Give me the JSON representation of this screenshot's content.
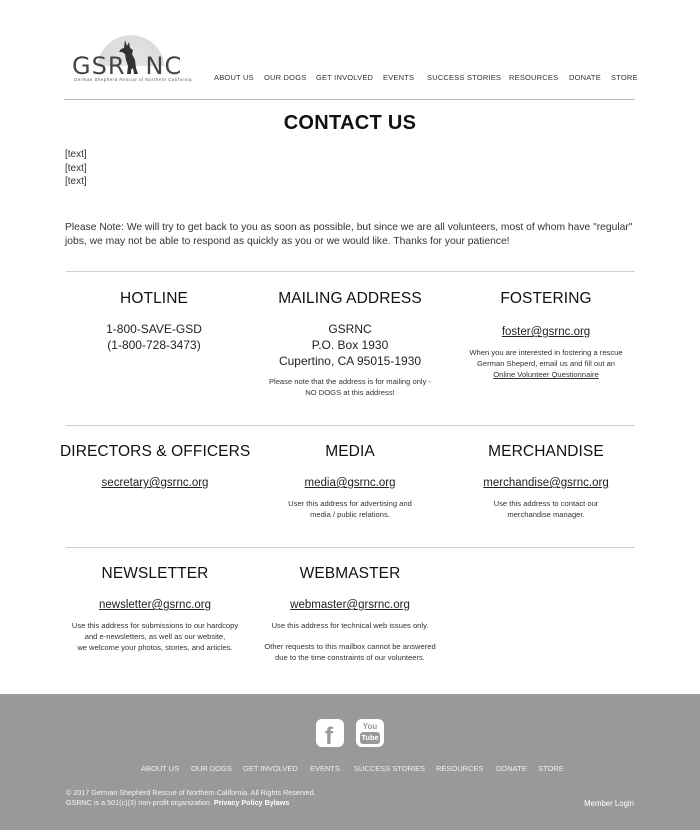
{
  "logo": {
    "text": "GSR",
    "text2": "NC",
    "subtitle": "German Shepherd Rescue of Northern California"
  },
  "nav": [
    {
      "label": "ABOUT US"
    },
    {
      "label": "OUR DOGS"
    },
    {
      "label": "GET INVOLVED"
    },
    {
      "label": "EVENTS"
    },
    {
      "label": "SUCCESS STORIES"
    },
    {
      "label": "RESOURCES"
    },
    {
      "label": "DONATE"
    },
    {
      "label": "STORE"
    }
  ],
  "main": {
    "title": "CONTACT US",
    "placeholders": [
      "[text]",
      "[text]",
      "[text]"
    ],
    "note": "Please Note: We will try to get back to you as soon as possible, but since we are all volunteers, most of whom have \"regular\" jobs, we may not be able to respond as quickly as you or we would like. Thanks for your patience!"
  },
  "contacts": {
    "hotline": {
      "title": "HOTLINE",
      "line1": "1-800-SAVE-GSD",
      "line2": "(1-800-728-3473)"
    },
    "mailing": {
      "title": "MAILING ADDRESS",
      "line1": "GSRNC",
      "line2": "P.O. Box 1930",
      "line3": "Cupertino, CA 95015-1930",
      "note1": "Please note that the address is for mailing only -",
      "note2": "NO DOGS at this address!"
    },
    "fostering": {
      "title": "FOSTERING",
      "email": "foster@gsrnc.org",
      "desc1": "When you are interested in fostering a rescue",
      "desc2": "German Sheperd, email us and fill out an",
      "link": "Online Volunteer Questionnaire"
    },
    "directors": {
      "title": "DIRECTORS & OFFICERS",
      "email": "secretary@gsrnc.org"
    },
    "media": {
      "title": "MEDIA",
      "email": "media@gsrnc.org",
      "desc1": "User this address for advertising and",
      "desc2": "media / public relations."
    },
    "merchandise": {
      "title": "MERCHANDISE",
      "email": "merchandise@gsrnc.org",
      "desc1": "Use this address to contact our",
      "desc2": "merchandise manager."
    },
    "newsletter": {
      "title": "NEWSLETTER",
      "email": "newsletter@gsrnc.org",
      "desc1": "Use this address for submissions to our hardcopy",
      "desc2": "and e-newsletters, as well as our website,",
      "desc3": "we welcome your photos, stories, and articles."
    },
    "webmaster": {
      "title": "WEBMASTER",
      "email": "webmaster@grsrnc.org",
      "desc1": "Use this address for technical web issues only.",
      "desc2": "Other requests to this mailbox cannot be answered",
      "desc3": "due to the time constraints of our volunteers."
    }
  },
  "footer": {
    "social": {
      "facebook_icon": "facebook-icon",
      "youtube_top": "You",
      "youtube_box": "Tube"
    },
    "nav": [
      {
        "label": "ABOUT US"
      },
      {
        "label": "OUR DOGS"
      },
      {
        "label": "GET INVOLVED"
      },
      {
        "label": "EVENTS"
      },
      {
        "label": "SUCCESS STORIES"
      },
      {
        "label": "RESOURCES"
      },
      {
        "label": "DONATE"
      },
      {
        "label": "STORE"
      }
    ],
    "copyright": "©  2017 German Shepherd Rescue of Northern California. All Rights Reserved.",
    "org_line": "GSRNC is a 501(c)(3) non-profit organization.",
    "privacy": "Privacy Policy",
    "bylaws": "Bylaws",
    "member_login": "Member Login"
  },
  "colors": {
    "footer_bg": "#999999",
    "rule": "#cfcfcf",
    "text": "#222222"
  }
}
